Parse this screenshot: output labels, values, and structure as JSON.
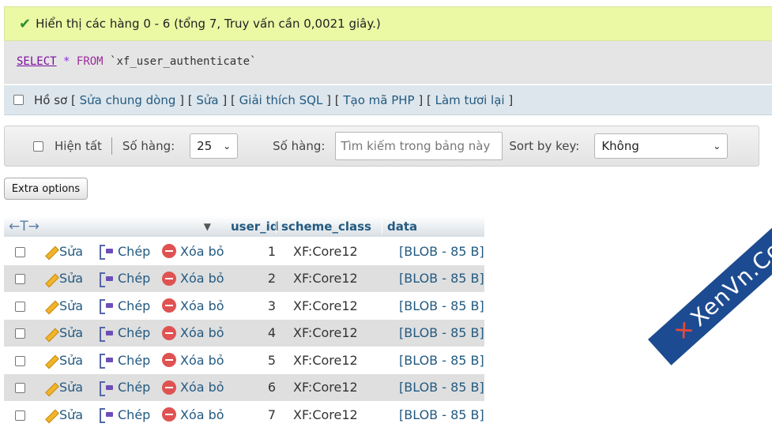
{
  "success_message": "Hiển thị các hàng 0 - 6 (tổng 7, Truy vấn cần 0,0021 giây.)",
  "sql": {
    "select": "SELECT",
    "star": "*",
    "from": "FROM",
    "table": "`xf_user_authenticate`"
  },
  "profile_bar": {
    "profile": "Hồ sơ",
    "links": [
      "Sửa chung dòng",
      "Sửa",
      "Giải thích SQL",
      "Tạo mã PHP",
      "Làm tươi lại"
    ]
  },
  "nav": {
    "show_all": "Hiện tất",
    "rows_label": "Số hàng:",
    "rows_value": "25",
    "search_label": "Số hàng:",
    "search_placeholder": "Tìm kiếm trong bảng này",
    "sort_label": "Sort by key:",
    "sort_value": "Không"
  },
  "extra_options": "Extra options",
  "table": {
    "arrows": "←T→",
    "columns": [
      "user_id",
      "scheme_class",
      "data"
    ],
    "actions": {
      "edit": "Sửa",
      "copy": "Chép",
      "delete": "Xóa bỏ"
    },
    "rows": [
      {
        "user_id": "1",
        "scheme_class": "XF:Core12",
        "data": "[BLOB - 85 B]"
      },
      {
        "user_id": "2",
        "scheme_class": "XF:Core12",
        "data": "[BLOB - 85 B]"
      },
      {
        "user_id": "3",
        "scheme_class": "XF:Core12",
        "data": "[BLOB - 85 B]"
      },
      {
        "user_id": "4",
        "scheme_class": "XF:Core12",
        "data": "[BLOB - 85 B]"
      },
      {
        "user_id": "5",
        "scheme_class": "XF:Core12",
        "data": "[BLOB - 85 B]"
      },
      {
        "user_id": "6",
        "scheme_class": "XF:Core12",
        "data": "[BLOB - 85 B]"
      },
      {
        "user_id": "7",
        "scheme_class": "XF:Core12",
        "data": "[BLOB - 85 B]"
      }
    ]
  },
  "watermark": "XenVn.Com"
}
